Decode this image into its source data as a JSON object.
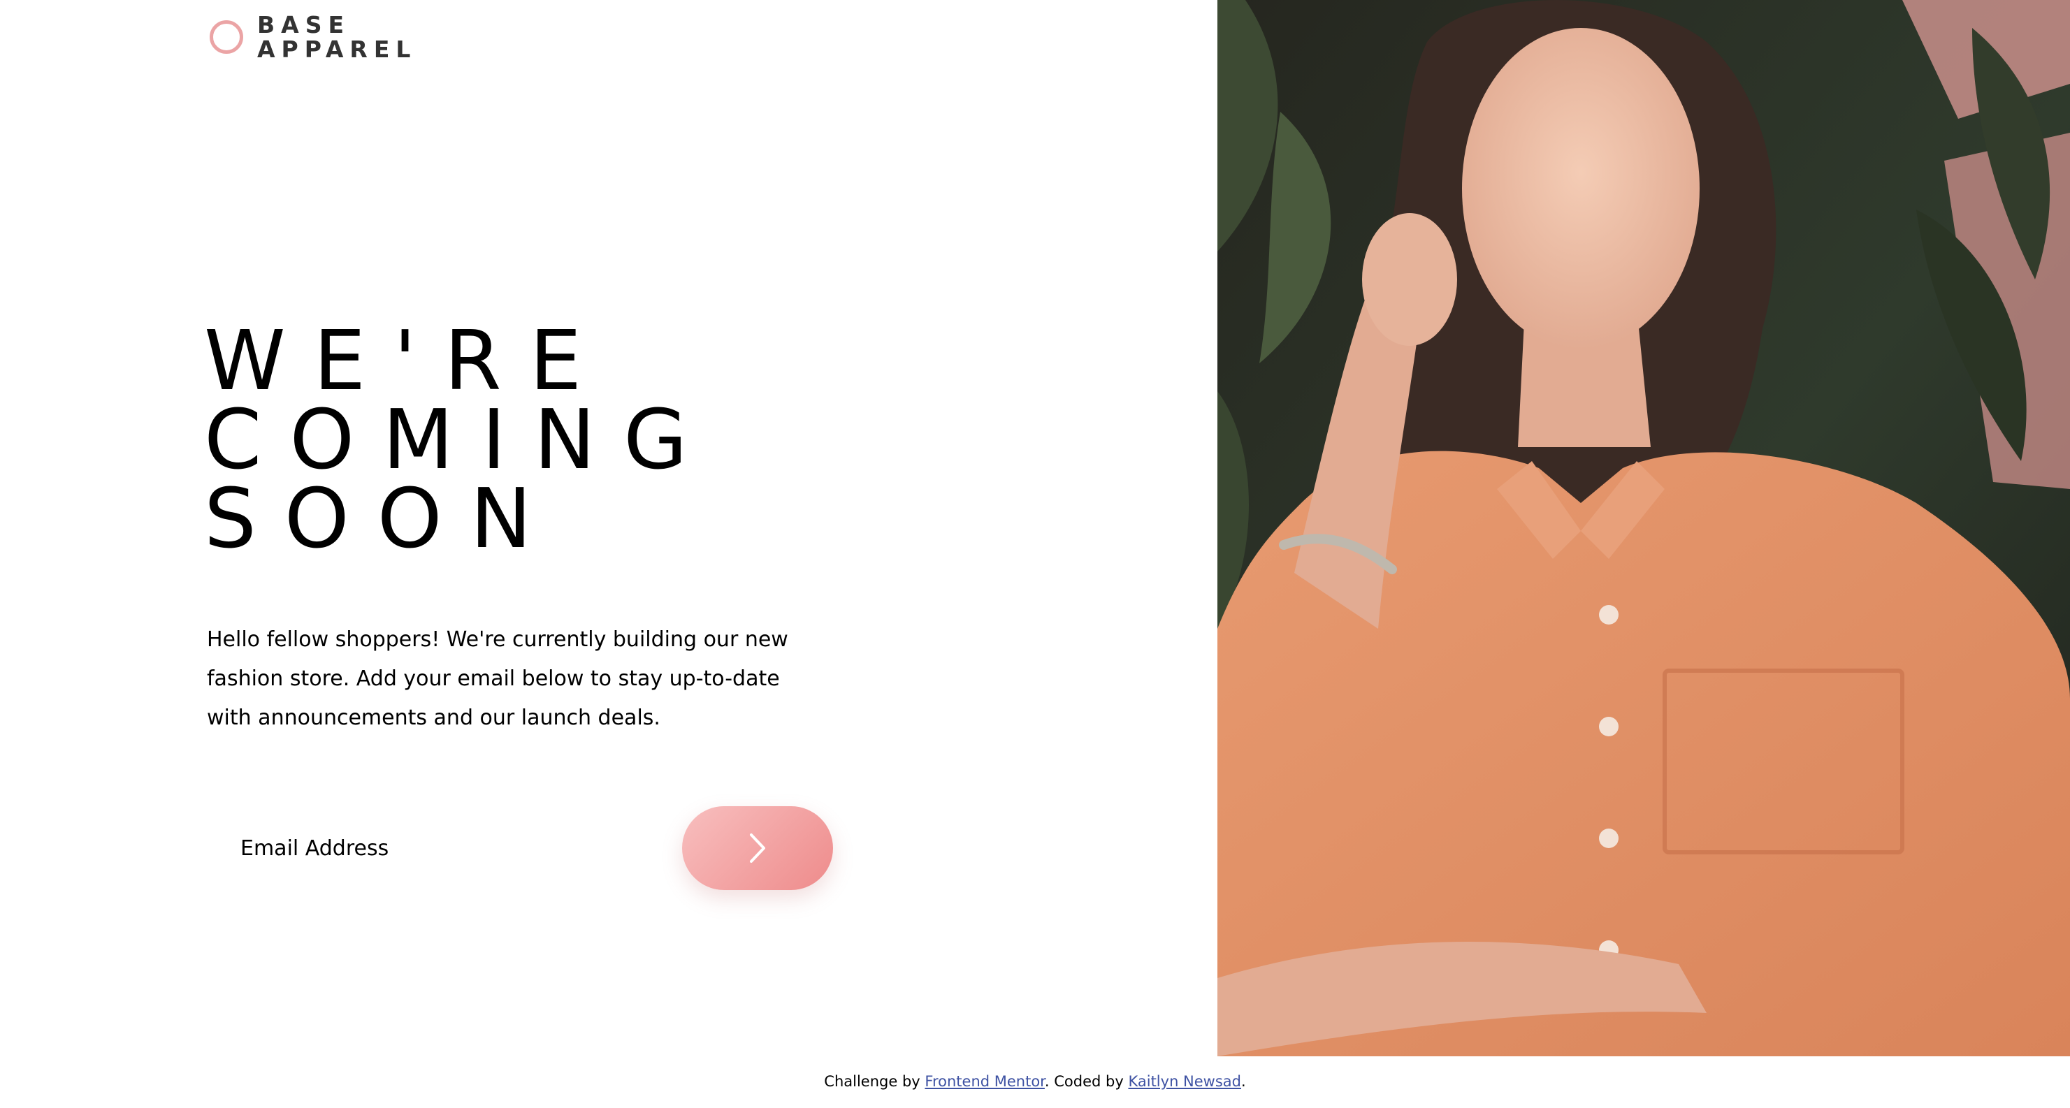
{
  "logo": {
    "line1": "BASE",
    "line2": "APPAREL"
  },
  "hero": {
    "headline_lines": [
      "WE'RE",
      "COMING",
      "SOON"
    ],
    "intro": "Hello fellow shoppers! We're currently building our new fashion store. Add your email below to stay up-to-date with announcements and our launch deals."
  },
  "form": {
    "email_placeholder": "Email Address",
    "submit_icon": "chevron-right-icon"
  },
  "attribution": {
    "prefix": "Challenge by ",
    "link1": "Frontend Mentor",
    "middle": ". Coded by ",
    "link2": "Kaitlyn Newsad",
    "suffix": "."
  },
  "colors": {
    "accent": "#eba4a5",
    "button_gradient_start": "#f8bfbf",
    "button_gradient_end": "#ee8b8b",
    "link": "#3e52a3"
  }
}
